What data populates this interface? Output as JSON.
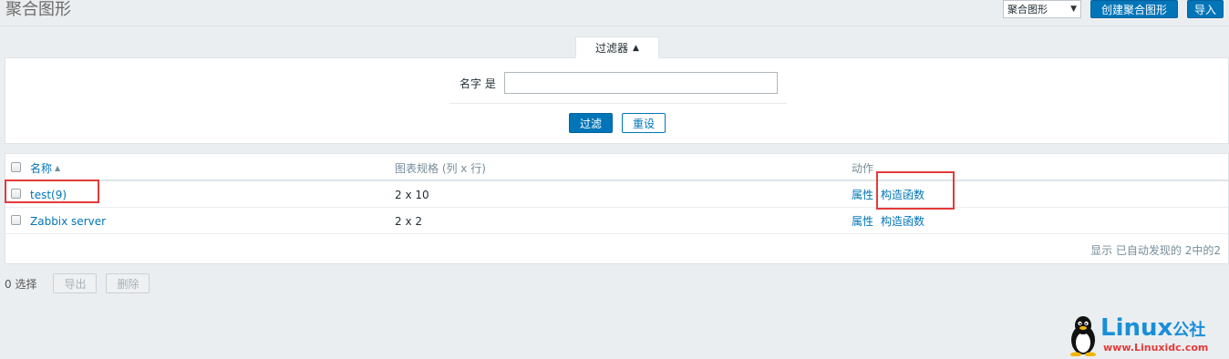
{
  "header": {
    "title": "聚合图形",
    "select_value": "聚合图形",
    "create_button": "创建聚合图形",
    "import_button": "导入"
  },
  "filter": {
    "tab_label": "过滤器",
    "name_label": "名字 是",
    "name_value": "",
    "apply_button": "过滤",
    "reset_button": "重设"
  },
  "table": {
    "columns": {
      "name": "名称",
      "size": "图表规格 (列 x 行)",
      "actions": "动作"
    },
    "rows": [
      {
        "name": "test(9)",
        "size": "2 x 10",
        "action_props": "属性",
        "action_constructor": "构造函数"
      },
      {
        "name": "Zabbix server",
        "size": "2 x 2",
        "action_props": "属性",
        "action_constructor": "构造函数"
      }
    ],
    "footer": "显示 已自动发现的 2中的2"
  },
  "bottom": {
    "selected_count": "0 选择",
    "export_button": "导出",
    "delete_button": "删除"
  },
  "watermark": {
    "brand": "Linux",
    "brand_cn": "公社",
    "url": "www.Linuxidc.com"
  },
  "colors": {
    "accent": "#0275b8",
    "highlight": "#e33a3a"
  }
}
